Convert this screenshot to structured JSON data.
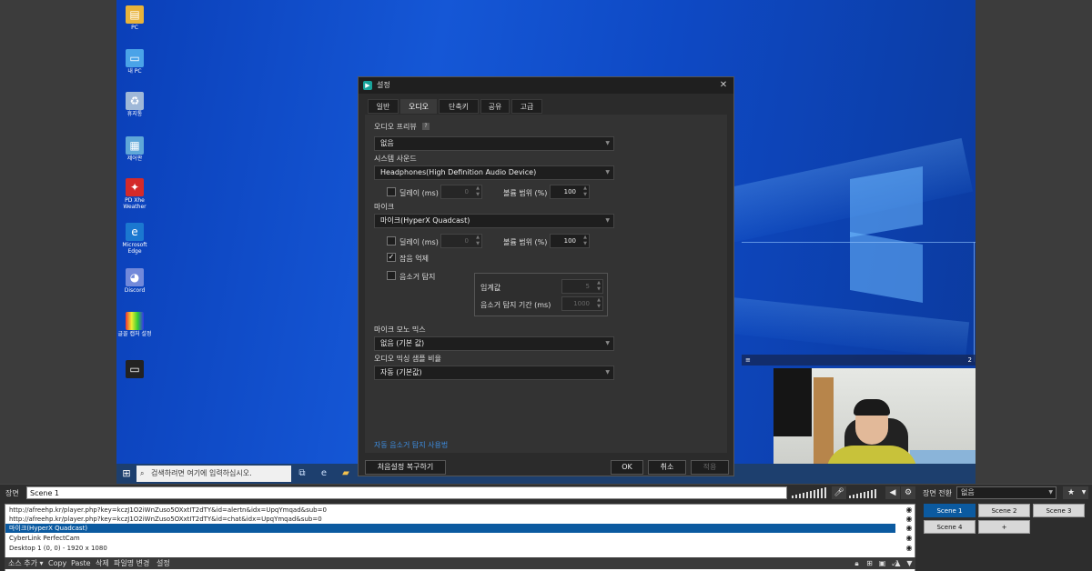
{
  "desktop": {
    "icons": [
      {
        "label": "PC",
        "icon": "user-folder-icon"
      },
      {
        "label": "내 PC",
        "icon": "computer-icon"
      },
      {
        "label": "휴지통",
        "icon": "recycle-bin-icon"
      },
      {
        "label": "제어판",
        "icon": "control-panel-icon"
      },
      {
        "label": "PD Xhe Weather",
        "icon": "app-icon"
      },
      {
        "label": "Microsoft Edge",
        "icon": "edge-icon"
      },
      {
        "label": "Discord",
        "icon": "discord-icon"
      },
      {
        "label": "글꼴 캡처 설정",
        "icon": "app-icon"
      },
      {
        "label": "",
        "icon": "monitor-icon"
      }
    ],
    "taskbar": {
      "search_placeholder": "검색하려면 여기에 입력하십시오."
    },
    "dock_panel_value": "2"
  },
  "dialog": {
    "title": "설정",
    "tabs": [
      "일반",
      "오디오",
      "단축키",
      "공유",
      "고급"
    ],
    "active_tab": "오디오",
    "audio_preview": {
      "label": "오디오 프리뷰",
      "value": "없음"
    },
    "system_sound": {
      "label": "시스템 사운드",
      "value": "Headphones(High Definition Audio Device)",
      "delay_label": "딜레이 (ms)",
      "delay_value": "0",
      "volume_label": "볼륨 범위 (%)",
      "volume_value": "100"
    },
    "mic": {
      "label": "마이크",
      "value": "마이크(HyperX Quadcast)",
      "delay_label": "딜레이 (ms)",
      "delay_value": "0",
      "volume_label": "볼륨 범위 (%)",
      "volume_value": "100"
    },
    "noise_suppression": {
      "label": "잡음 억제",
      "checked": true
    },
    "noise_gate": {
      "label": "음소거 탐지",
      "checked": false,
      "threshold_label": "임계값",
      "threshold_value": "5",
      "duration_label": "음소거 탐지 기간 (ms)",
      "duration_value": "1000"
    },
    "mic_mono_mix": {
      "label": "마이크 모노 믹스",
      "value": "없음 (기본 값)"
    },
    "mixing_sample_rate": {
      "label": "오디오 믹싱 샘플 비율",
      "value": "자동 (기본값)"
    },
    "auto_noise_link": "자동 음소거 탐지 사용법",
    "buttons": {
      "reset": "처음설정 복구하기",
      "ok": "OK",
      "cancel": "취소",
      "apply": "적용"
    }
  },
  "bottom": {
    "scene_label": "장면",
    "scene_name": "Scene 1",
    "transition_label": "장면 전환",
    "transition_value": "없음",
    "sources": [
      "http://afreehp.kr/player.php?key=kczJ1O2iWnZuso5OXxtIT2dTY&id=alertn&idx=UpqYmqad&sub=0",
      "http://afreehp.kr/player.php?key=kczJ1O2iWnZuso5OXxtIT2dTY&id=chat&idx=UpqYmqad&sub=0",
      "마이크(HyperX Quadcast)",
      "CyberLink PerfectCam",
      "Desktop 1 (0, 0) - 1920 x 1080"
    ],
    "selected_source_index": 2,
    "source_toolbar": [
      "소스 추가 ▾",
      "Copy",
      "Paste",
      "삭제",
      "파일명 변경",
      "설정"
    ],
    "scenes": [
      "Scene 1",
      "Scene 2",
      "Scene 3",
      "Scene 4",
      "+"
    ],
    "active_scene": "Scene 1"
  }
}
